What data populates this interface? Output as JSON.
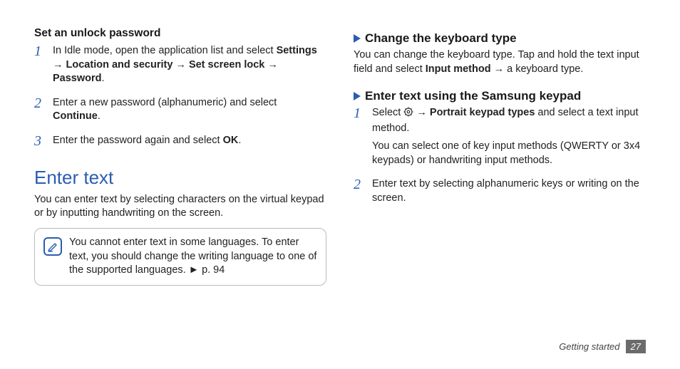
{
  "left": {
    "h_set_password": "Set an unlock password",
    "steps": [
      {
        "num": "1",
        "pre": "In Idle mode, open the application list and select ",
        "bold": "Settings → Location and security → Set screen lock → Password",
        "post": "."
      },
      {
        "num": "2",
        "pre": "Enter a new password (alphanumeric) and select ",
        "bold": "Continue",
        "post": "."
      },
      {
        "num": "3",
        "pre": "Enter the password again and select ",
        "bold": "OK",
        "post": "."
      }
    ],
    "big_heading": "Enter text",
    "intro": "You can enter text by selecting characters on the virtual keypad or by inputting handwriting on the screen.",
    "note": "You cannot enter text in some languages. To enter text, you should change the writing language to one of the supported languages. ► p. 94"
  },
  "right": {
    "sub1": "Change the keyboard type",
    "sub1_para_pre": "You can change the keyboard type. Tap and hold the text input field and select ",
    "sub1_para_bold": "Input method",
    "sub1_para_post": " → a keyboard type.",
    "sub2": "Enter text using the Samsung keypad",
    "steps": [
      {
        "num": "1",
        "pre": "Select ",
        "gear_after": " → ",
        "bold": "Portrait keypad types",
        "post": " and select a text input method.",
        "extra": "You can select one of key input methods (QWERTY or 3x4 keypads) or handwriting input methods."
      },
      {
        "num": "2",
        "pre": "Enter text by selecting alphanumeric keys or writing on the screen.",
        "bold": "",
        "post": "",
        "gear_after": "",
        "extra": ""
      }
    ]
  },
  "footer": {
    "label": "Getting started",
    "page": "27"
  }
}
